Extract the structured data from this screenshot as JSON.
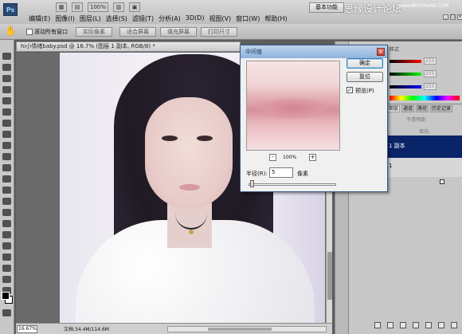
{
  "app": {
    "logo": "Ps"
  },
  "topbar": {
    "zoom_display": "100%",
    "workspace_button": "基本功能",
    "watermark": "思缘设计论坛",
    "watermark_url": "www.MISSYUAN.COM"
  },
  "menu": {
    "items": [
      "编辑(E)",
      "图像(I)",
      "图层(L)",
      "选择(S)",
      "滤镜(T)",
      "分析(A)",
      "3D(D)",
      "视图(V)",
      "窗口(W)",
      "帮助(H)"
    ]
  },
  "options": {
    "scroll_all_label": "滚动所有窗口",
    "buttons": [
      "实际像素",
      "适合屏幕",
      "填充屏幕",
      "打印尺寸"
    ]
  },
  "document": {
    "tab_title": "hi小情绪baby.psd @ 16.7% (图层 1 副本, RGB/8) *",
    "zoom": "16.67%",
    "doc_info": "文档:34.4M/114.6M"
  },
  "dialog": {
    "title": "中间值",
    "close": "x",
    "ok": "确定",
    "reset": "复位",
    "preview_label": "预览(P)",
    "preview_checked": "✓",
    "zoom_pct": "100%",
    "zoom_minus": "-",
    "zoom_plus": "+",
    "radius_label": "半径(R):",
    "radius_value": "5",
    "radius_unit": "像素"
  },
  "right_panel": {
    "color_tab": "样式",
    "color_values": [
      "255",
      "255",
      "255"
    ],
    "layer_tabs": [
      "图层",
      "通道",
      "路径",
      "历史记录"
    ],
    "opacity_label": "不透明度:",
    "fill_label": "填充:",
    "layers": [
      "1 副本",
      "1"
    ]
  },
  "colors": {
    "accent": "#0a246a",
    "title_bar": "#8fb2db"
  }
}
